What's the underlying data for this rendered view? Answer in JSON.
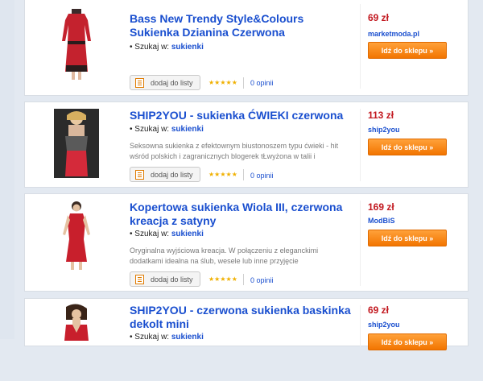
{
  "products": [
    {
      "title": "Bass New Trendy Style&Colours Sukienka Dzianina Czerwona",
      "search_prefix": "• Szukaj w:",
      "search_link": "sukienki",
      "description": "",
      "add_label": "dodaj do listy",
      "stars": "★★★★★",
      "opinions": "0 opinii",
      "price": "69 zł",
      "shop": "marketmoda.pl",
      "go_label": "Idź do sklepu »"
    },
    {
      "title": "SHIP2YOU - sukienka ĆWIEKI czerwona",
      "search_prefix": "• Szukaj w:",
      "search_link": "sukienki",
      "description": "Seksowna sukienka z efektownym biustonoszem typu ćwieki - hit wśród polskich i zagranicznych blogerek tŁwyżona w talii i poszerzana",
      "add_label": "dodaj do listy",
      "stars": "★★★★★",
      "opinions": "0 opinii",
      "price": "113 zł",
      "shop": "ship2you",
      "go_label": "Idź do sklepu »"
    },
    {
      "title": "Kopertowa sukienka Wiola III, czerwona kreacja z satyny",
      "search_prefix": "• Szukaj w:",
      "search_link": "sukienki",
      "description": "Oryginalna wyjściowa kreacja. W połączeniu z eleganckimi dodatkami idealna na ślub, wesele lub inne przyjęcie okolicznościowe. Sukienka",
      "add_label": "dodaj do listy",
      "stars": "★★★★★",
      "opinions": "0 opinii",
      "price": "169 zł",
      "shop": "ModBiS",
      "go_label": "Idź do sklepu »"
    },
    {
      "title": "SHIP2YOU - czerwona sukienka baskinka dekolt mini",
      "search_prefix": "• Szukaj w:",
      "search_link": "sukienki",
      "description": "",
      "add_label": "dodaj do listy",
      "stars": "★★★★★",
      "opinions": "0 opinii",
      "price": "69 zł",
      "shop": "ship2you",
      "go_label": "Idź do sklepu »"
    }
  ],
  "colors": {
    "link": "#1a4fcf",
    "price": "#c2181f",
    "button": "#f27500"
  }
}
